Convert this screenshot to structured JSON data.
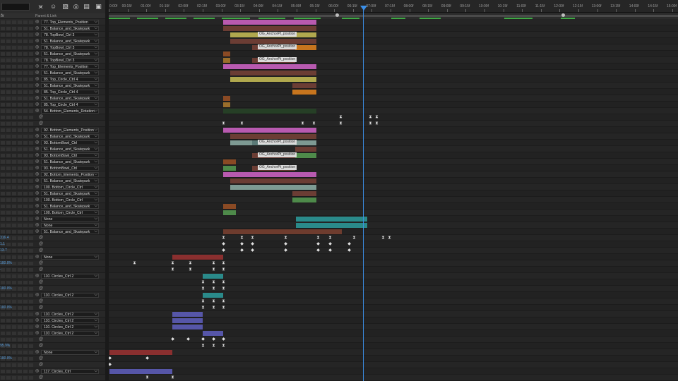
{
  "ruler": {
    "ticks": [
      "0:00f",
      "00:15f",
      "01:00f",
      "01:15f",
      "02:00f",
      "02:15f",
      "03:00f",
      "03:15f",
      "04:00f",
      "04:15f",
      "05:00f",
      "05:15f",
      "06:00f",
      "06:15f",
      "07:00f",
      "07:15f",
      "08:00f",
      "08:15f",
      "09:00f",
      "09:15f",
      "10:00f",
      "10:15f",
      "11:00f",
      "11:15f",
      "12:00f",
      "12:15f",
      "13:00f",
      "13:15f",
      "14:00f",
      "14:15f",
      "15:00f"
    ]
  },
  "header": {
    "fx_label": "fx",
    "parent_label": "Parent & Link"
  },
  "left_rows": [
    {
      "type": "parent",
      "label": "77. Top_Elements_Position"
    },
    {
      "type": "parent",
      "label": "51. Balance_and_Skatepark"
    },
    {
      "type": "parent",
      "label": "78. TopBowl_Ctrl 3"
    },
    {
      "type": "parent",
      "label": "51. Balance_and_Skatepark"
    },
    {
      "type": "parent",
      "label": "78. TopBowl_Ctrl 3"
    },
    {
      "type": "parent",
      "label": "51. Balance_and_Skatepark"
    },
    {
      "type": "parent",
      "label": "78. TopBowl_Ctrl 3"
    },
    {
      "type": "parent",
      "label": "77. Top_Elements_Position"
    },
    {
      "type": "parent",
      "label": "51. Balance_and_Skatepark"
    },
    {
      "type": "parent",
      "label": "85. Top_Circle_Ctrl 4"
    },
    {
      "type": "parent",
      "label": "51. Balance_and_Skatepark"
    },
    {
      "type": "parent",
      "label": "85. Top_Circle_Ctrl 4"
    },
    {
      "type": "parent",
      "label": "51. Balance_and_Skatepark"
    },
    {
      "type": "parent",
      "label": "85. Top_Circle_Ctrl 4"
    },
    {
      "type": "parent",
      "label": "54. Bottom_Elements_Rotation"
    },
    {
      "type": "prop",
      "value": ""
    },
    {
      "type": "prop",
      "value": ""
    },
    {
      "type": "parent",
      "label": "92. Bottom_Elements_Position"
    },
    {
      "type": "parent",
      "label": "51. Balance_and_Skatepark"
    },
    {
      "type": "parent",
      "label": "93. BottomBowl_Ctrl"
    },
    {
      "type": "parent",
      "label": "51. Balance_and_Skatepark"
    },
    {
      "type": "parent",
      "label": "93. BottomBowl_Ctrl"
    },
    {
      "type": "parent",
      "label": "51. Balance_and_Skatepark"
    },
    {
      "type": "parent",
      "label": "93. BottomBowl_Ctrl"
    },
    {
      "type": "parent",
      "label": "92. Bottom_Elements_Position"
    },
    {
      "type": "parent",
      "label": "51. Balance_and_Skatepark"
    },
    {
      "type": "parent",
      "label": "100. Bottom_Circle_Ctrl"
    },
    {
      "type": "parent",
      "label": "51. Balance_and_Skatepark"
    },
    {
      "type": "parent",
      "label": "100. Bottom_Circle_Ctrl"
    },
    {
      "type": "parent",
      "label": "51. Balance_and_Skatepark"
    },
    {
      "type": "parent",
      "label": "100. Bottom_Circle_Ctrl"
    },
    {
      "type": "parent",
      "label": "None"
    },
    {
      "type": "parent",
      "label": "None"
    },
    {
      "type": "parent",
      "label": "51. Balance_and_Skatepark"
    },
    {
      "type": "prop",
      "value": "316.4"
    },
    {
      "type": "prop",
      "value": "1.1"
    },
    {
      "type": "prop",
      "value": "13.7"
    },
    {
      "type": "parent",
      "label": "None"
    },
    {
      "type": "prop",
      "value": "100.0%"
    },
    {
      "type": "prop",
      "value": "-"
    },
    {
      "type": "parent",
      "label": "110. Circles_Ctrl 2"
    },
    {
      "type": "prop",
      "value": ""
    },
    {
      "type": "prop",
      "value": "100.0%"
    },
    {
      "type": "parent",
      "label": "110. Circles_Ctrl 2"
    },
    {
      "type": "prop",
      "value": ""
    },
    {
      "type": "prop",
      "value": "100.0%"
    },
    {
      "type": "parent",
      "label": "110. Circles_Ctrl 2"
    },
    {
      "type": "parent",
      "label": "110. Circles_Ctrl 2"
    },
    {
      "type": "parent",
      "label": "110. Circles_Ctrl 2"
    },
    {
      "type": "parent",
      "label": "110. Circles_Ctrl 2"
    },
    {
      "type": "prop",
      "value": ""
    },
    {
      "type": "prop",
      "value": "95.9%"
    },
    {
      "type": "parent",
      "label": "None"
    },
    {
      "type": "prop",
      "value": "100.0%"
    },
    {
      "type": "prop",
      "value": ""
    },
    {
      "type": "parent",
      "label": "117. Circles_Ctrl"
    },
    {
      "type": "prop",
      "value": ""
    }
  ],
  "colors": {
    "magenta": "#b85ab0",
    "brown": "#6b3d34",
    "olive": "#b0a84e",
    "orange": "#c7751e",
    "darkgreen": "#263f26",
    "sage": "#7e9a93",
    "green": "#4e8a4a",
    "teal": "#2a8a8a",
    "rust": "#6e3c2e",
    "red": "#8a2f2f",
    "periwinkle": "#5656a8",
    "orangebrown": "#8a4a24",
    "ochre": "#9a6e2b",
    "slate": "#5b7a77",
    "playhead": "#3b8fe8"
  },
  "bars": [
    {
      "row": 0,
      "start": 162,
      "end": 294,
      "color": "magenta"
    },
    {
      "row": 1,
      "start": 162,
      "end": 294,
      "color": "brown"
    },
    {
      "row": 2,
      "start": 172,
      "end": 294,
      "color": "olive"
    },
    {
      "row": 2,
      "start": 203,
      "end": 270,
      "color": "olive",
      "label": "OG_AnchorPt_position"
    },
    {
      "row": 3,
      "start": 172,
      "end": 294,
      "color": "brown"
    },
    {
      "row": 4,
      "start": 264,
      "end": 294,
      "color": "orange"
    },
    {
      "row": 4,
      "start": 203,
      "end": 264,
      "color": "brown",
      "label": "OG_AnchorPt_position"
    },
    {
      "row": 5,
      "start": 162,
      "end": 172,
      "color": "orangebrown"
    },
    {
      "row": 6,
      "start": 162,
      "end": 172,
      "color": "ochre"
    },
    {
      "row": 6,
      "start": 203,
      "end": 264,
      "color": "brown",
      "label": "OG_AnchorPt_position"
    },
    {
      "row": 7,
      "start": 162,
      "end": 294,
      "color": "magenta"
    },
    {
      "row": 8,
      "start": 172,
      "end": 294,
      "color": "brown"
    },
    {
      "row": 9,
      "start": 172,
      "end": 294,
      "color": "olive"
    },
    {
      "row": 10,
      "start": 260,
      "end": 294,
      "color": "brown"
    },
    {
      "row": 11,
      "start": 260,
      "end": 294,
      "color": "orange"
    },
    {
      "row": 12,
      "start": 162,
      "end": 172,
      "color": "orangebrown"
    },
    {
      "row": 13,
      "start": 162,
      "end": 172,
      "color": "ochre"
    },
    {
      "row": 14,
      "start": 162,
      "end": 294,
      "color": "darkgreen"
    },
    {
      "row": 17,
      "start": 162,
      "end": 294,
      "color": "magenta"
    },
    {
      "row": 18,
      "start": 172,
      "end": 294,
      "color": "brown"
    },
    {
      "row": 19,
      "start": 172,
      "end": 294,
      "color": "sage"
    },
    {
      "row": 19,
      "start": 203,
      "end": 264,
      "color": "slate",
      "label": "OG_AnchorPt_position"
    },
    {
      "row": 20,
      "start": 264,
      "end": 294,
      "color": "brown"
    },
    {
      "row": 21,
      "start": 264,
      "end": 294,
      "color": "green"
    },
    {
      "row": 21,
      "start": 203,
      "end": 264,
      "color": "brown",
      "label": "OG_AnchorPt_position"
    },
    {
      "row": 22,
      "start": 162,
      "end": 180,
      "color": "orangebrown"
    },
    {
      "row": 23,
      "start": 162,
      "end": 180,
      "color": "green"
    },
    {
      "row": 23,
      "start": 203,
      "end": 264,
      "color": "brown",
      "label": "OG_AnchorPt_position"
    },
    {
      "row": 24,
      "start": 162,
      "end": 294,
      "color": "magenta"
    },
    {
      "row": 25,
      "start": 172,
      "end": 294,
      "color": "brown"
    },
    {
      "row": 26,
      "start": 172,
      "end": 294,
      "color": "sage"
    },
    {
      "row": 27,
      "start": 260,
      "end": 294,
      "color": "brown"
    },
    {
      "row": 28,
      "start": 260,
      "end": 294,
      "color": "green"
    },
    {
      "row": 29,
      "start": 162,
      "end": 180,
      "color": "orangebrown"
    },
    {
      "row": 30,
      "start": 162,
      "end": 180,
      "color": "green"
    },
    {
      "row": 31,
      "start": 265,
      "end": 366,
      "color": "teal"
    },
    {
      "row": 32,
      "start": 265,
      "end": 366,
      "color": "teal"
    },
    {
      "row": 33,
      "start": 162,
      "end": 330,
      "color": "rust"
    },
    {
      "row": 37,
      "start": 90,
      "end": 162,
      "color": "red"
    },
    {
      "row": 40,
      "start": 133,
      "end": 162,
      "color": "teal"
    },
    {
      "row": 43,
      "start": 133,
      "end": 162,
      "color": "teal"
    },
    {
      "row": 46,
      "start": 90,
      "end": 133,
      "color": "periwinkle"
    },
    {
      "row": 47,
      "start": 90,
      "end": 133,
      "color": "periwinkle"
    },
    {
      "row": 48,
      "start": 90,
      "end": 133,
      "color": "periwinkle"
    },
    {
      "row": 49,
      "start": 133,
      "end": 162,
      "color": "periwinkle"
    },
    {
      "row": 52,
      "start": 1,
      "end": 90,
      "color": "red"
    },
    {
      "row": 55,
      "start": 1,
      "end": 90,
      "color": "periwinkle"
    }
  ],
  "keyframes": [
    {
      "row": 15,
      "x": [
        328,
        370,
        379
      ]
    },
    {
      "row": 16,
      "x": [
        162,
        188,
        274,
        290,
        328,
        370,
        379
      ]
    },
    {
      "row": 34,
      "x": [
        162,
        188,
        203,
        250,
        296,
        313,
        347,
        388,
        397
      ]
    },
    {
      "row": 35,
      "x": [
        162,
        188,
        203,
        250,
        296,
        313,
        340
      ]
    },
    {
      "row": 36,
      "x": [
        162,
        188,
        203,
        250,
        296,
        313,
        340
      ]
    },
    {
      "row": 38,
      "x": [
        36,
        90,
        115,
        148,
        162
      ]
    },
    {
      "row": 39,
      "x": [
        90,
        115,
        148,
        162
      ]
    },
    {
      "row": 41,
      "x": [
        133,
        148,
        162
      ]
    },
    {
      "row": 42,
      "x": [
        133,
        148,
        162
      ]
    },
    {
      "row": 44,
      "x": [
        133,
        148,
        162
      ]
    },
    {
      "row": 45,
      "x": [
        133,
        148,
        162
      ]
    },
    {
      "row": 50,
      "x": [
        90,
        112,
        133,
        148,
        162
      ]
    },
    {
      "row": 51,
      "x": [
        133,
        148,
        162
      ]
    },
    {
      "row": 53,
      "x": [
        1,
        54
      ]
    },
    {
      "row": 54,
      "x": [
        1
      ]
    },
    {
      "row": 56,
      "x": [
        54,
        90
      ]
    }
  ],
  "playhead_frame": "06:15f"
}
